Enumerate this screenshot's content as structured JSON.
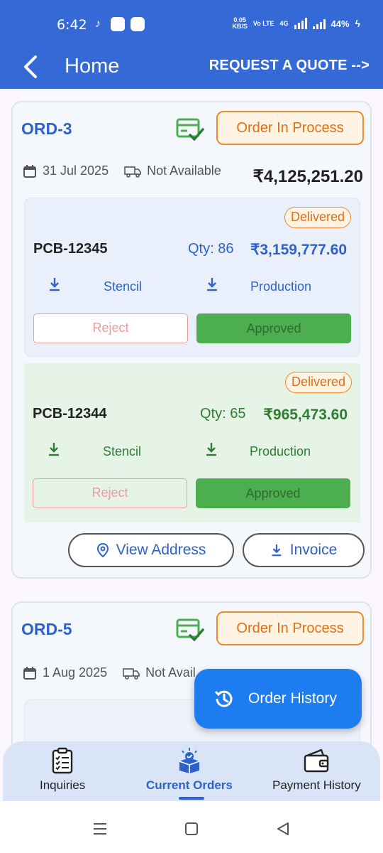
{
  "status_bar": {
    "time": "6:42",
    "net_speed": "0.05",
    "net_unit": "KB/S",
    "volte": "Vo LTE",
    "network": "4G",
    "battery": "44%"
  },
  "header": {
    "title": "Home",
    "action": "REQUEST A QUOTE -->"
  },
  "orders": [
    {
      "id": "ORD-3",
      "status": "Order In Process",
      "date": "31 Jul 2025",
      "shipping": "Not Available",
      "total": "₹4,125,251.20",
      "items": [
        {
          "badge": "Delivered",
          "pcb": "PCB-12345",
          "qty": "Qty: 86",
          "price": "₹3,159,777.60",
          "stencil": "Stencil",
          "production": "Production",
          "reject": "Reject",
          "approved": "Approved"
        },
        {
          "badge": "Delivered",
          "pcb": "PCB-12344",
          "qty": "Qty: 65",
          "price": "₹965,473.60",
          "stencil": "Stencil",
          "production": "Production",
          "reject": "Reject",
          "approved": "Approved"
        }
      ],
      "view_address": "View Address",
      "invoice": "Invoice"
    },
    {
      "id": "ORD-5",
      "status": "Order In Process",
      "date": "1 Aug 2025",
      "shipping": "Not Avail"
    }
  ],
  "fab": {
    "label": "Order History"
  },
  "bottom_nav": [
    {
      "label": "Inquiries"
    },
    {
      "label": "Current Orders"
    },
    {
      "label": "Payment History"
    }
  ],
  "colors": {
    "primary": "#3569d6",
    "accent_orange": "#ef8a2c",
    "approve_green": "#4cae4f",
    "fab_blue": "#1e7cf1"
  }
}
